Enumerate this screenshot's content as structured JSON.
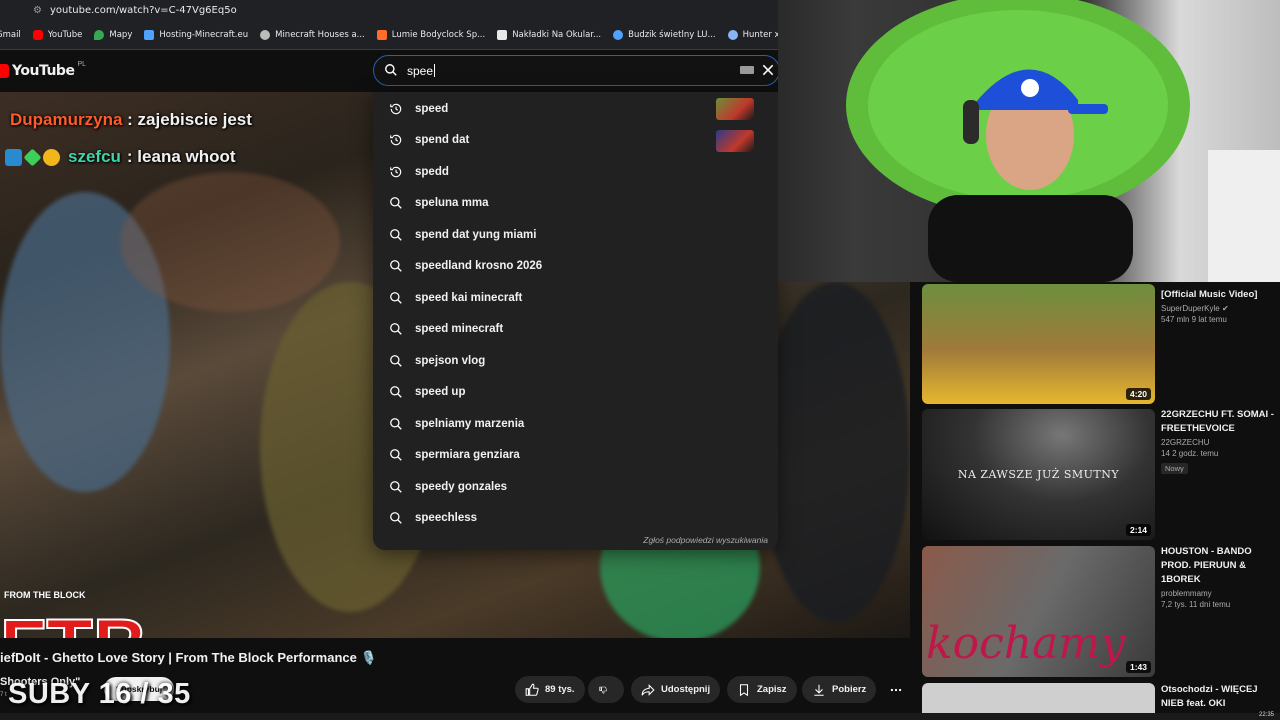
{
  "browser": {
    "url": "youtube.com/watch?v=C-47Vg6Eq5o",
    "bookmarks": [
      {
        "label": "Gmail",
        "color": "#ea4335"
      },
      {
        "label": "YouTube",
        "color": "#ff0000"
      },
      {
        "label": "Mapy",
        "color": "#34a853"
      },
      {
        "label": "Hosting-Minecraft.eu",
        "color": "#4fa3ff"
      },
      {
        "label": "Minecraft Houses a...",
        "color": "#bbbbbb"
      },
      {
        "label": "Lumie Bodyclock Sp...",
        "color": "#ff6d2a"
      },
      {
        "label": "Nakładki Na Okular...",
        "color": "#e8e8e8"
      },
      {
        "label": "Budzik świetlny LU...",
        "color": "#4fa3ff"
      },
      {
        "label": "Hunter x Hunter: Th",
        "color": "#8ab4f8"
      }
    ]
  },
  "youtube": {
    "logo_text": "YouTube",
    "region": "PL",
    "search_query": "spee",
    "suggestions": [
      {
        "text": "speed",
        "kind": "history",
        "thumb": "#6b8f3a"
      },
      {
        "text": "spend dat",
        "kind": "history",
        "thumb": "#2b3a8a"
      },
      {
        "text": "spedd",
        "kind": "history"
      },
      {
        "text": "speluna mma",
        "kind": "search"
      },
      {
        "text": "spend dat yung miami",
        "kind": "search"
      },
      {
        "text": "speedland krosno 2026",
        "kind": "search"
      },
      {
        "text": "speed kai minecraft",
        "kind": "search"
      },
      {
        "text": "speed minecraft",
        "kind": "search"
      },
      {
        "text": "spejson vlog",
        "kind": "search"
      },
      {
        "text": "speed up",
        "kind": "search"
      },
      {
        "text": "spelniamy marzenia",
        "kind": "search"
      },
      {
        "text": "spermiara genziara",
        "kind": "search"
      },
      {
        "text": "speedy gonzales",
        "kind": "search"
      },
      {
        "text": "speechless",
        "kind": "search"
      }
    ],
    "report_suggestions": "Zgłoś podpowiedzi wyszukiwania"
  },
  "chat": [
    {
      "user": "Dupamurzyna",
      "message": ": zajebiscie jest"
    },
    {
      "user": "szefcu",
      "message": ": leana whoot"
    }
  ],
  "video": {
    "title": "iefDoIt - Ghetto Love Story | From The Block Performance 🎙️",
    "overlay_brand": "FTB",
    "overlay_brand_sub": "FROM THE BLOCK",
    "channel": "Shooters Only\"",
    "subscribers": "7 t",
    "subscribe_label": "Subskrybuj",
    "overlay_subs_counter": "SUBY 16 / 35",
    "likes": "89 tys.",
    "share_label": "Udostępnij",
    "save_label": "Zapisz",
    "download_label": "Pobierz"
  },
  "recommendations": [
    {
      "title": "[Official Music Video]",
      "channel": "SuperDuperKyle",
      "verified": true,
      "meta": "547 mln  9 lat temu",
      "duration": "4:20",
      "thumb_colors": [
        "#5a7a3a",
        "#c8a030"
      ]
    },
    {
      "title": "22GRZECHU FT. SOMAI - FREETHEVOICE",
      "channel": "22GRZECHU",
      "meta": "14  2 godz. temu",
      "badge": "Nowy",
      "duration": "2:14",
      "thumb_text": "NA ZAWSZE JUŻ SMUTNY",
      "thumb_colors": [
        "#555555",
        "#1a1a1a"
      ]
    },
    {
      "title": "HOUSTON - BANDO PROD. PIERUUN & 1BOREK",
      "channel": "problemmamy",
      "meta": "7,2 tys.  11 dni temu",
      "duration": "1:43",
      "thumb_text": "kochamy",
      "thumb_colors": [
        "#8a6a5a",
        "#3a3a3a"
      ]
    },
    {
      "title": "Otsochodzi - WIĘCEJ NIEB feat. OKI"
    }
  ],
  "system": {
    "clock": "22:35"
  }
}
